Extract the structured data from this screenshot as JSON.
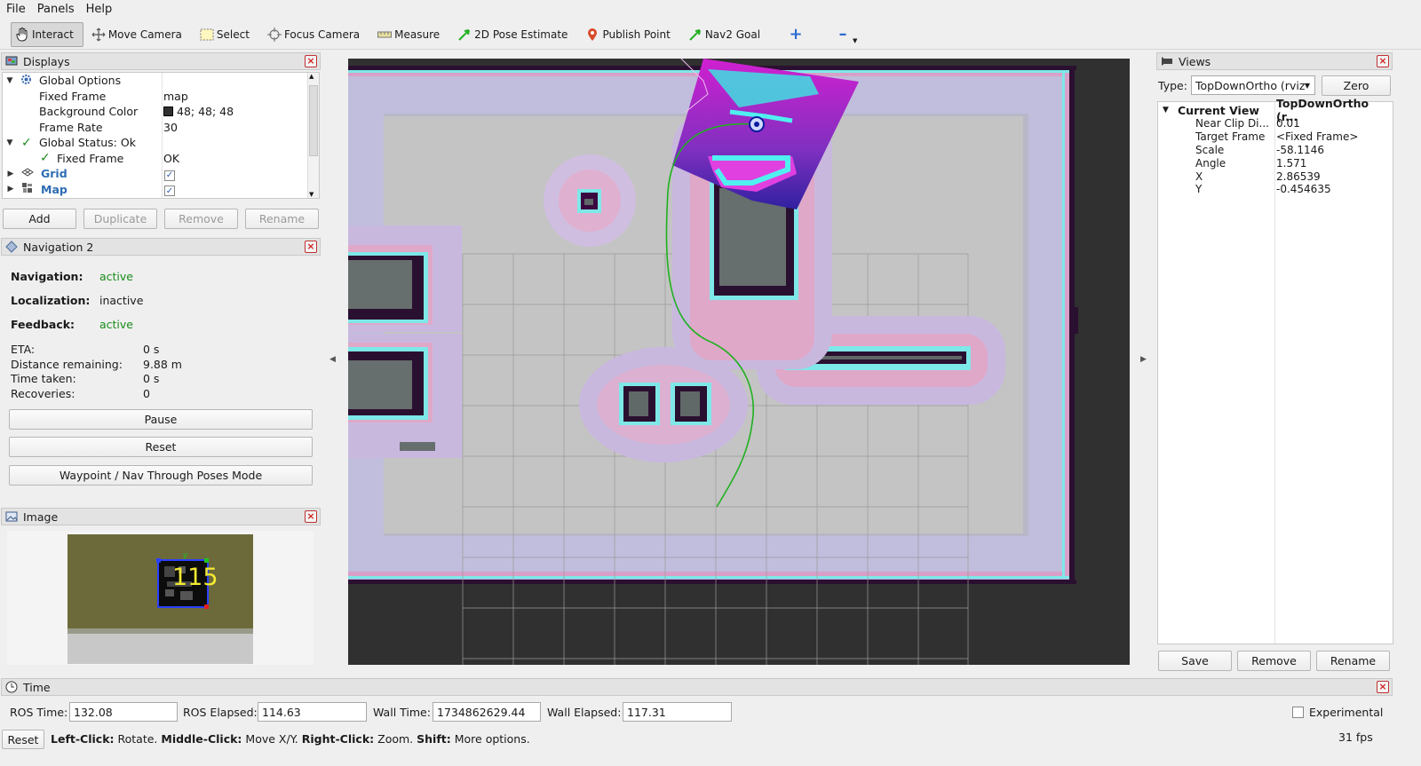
{
  "menu": [
    "File",
    "Panels",
    "Help"
  ],
  "toolbar": {
    "interact": "Interact",
    "move_camera": "Move Camera",
    "select": "Select",
    "focus_camera": "Focus Camera",
    "measure": "Measure",
    "pose_estimate": "2D Pose Estimate",
    "publish_point": "Publish Point",
    "nav2_goal": "Nav2 Goal"
  },
  "displays": {
    "title": "Displays",
    "rows": {
      "global_options": "Global Options",
      "fixed_frame": "Fixed Frame",
      "fixed_frame_val": "map",
      "background_color": "Background Color",
      "background_color_val": "48; 48; 48",
      "background_color_hex": "#303030",
      "frame_rate": "Frame Rate",
      "frame_rate_val": "30",
      "global_status": "Global Status: Ok",
      "status_fixed_frame": "Fixed Frame",
      "status_fixed_frame_val": "OK",
      "grid": "Grid",
      "map": "Map"
    },
    "buttons": {
      "add": "Add",
      "duplicate": "Duplicate",
      "remove": "Remove",
      "rename": "Rename"
    }
  },
  "navigation": {
    "title": "Navigation 2",
    "navigation_label": "Navigation:",
    "navigation_val": "active",
    "localization_label": "Localization:",
    "localization_val": "inactive",
    "feedback_label": "Feedback:",
    "feedback_val": "active",
    "eta_label": "ETA:",
    "eta_val": "0 s",
    "distance_label": "Distance remaining:",
    "distance_val": "9.88 m",
    "time_label": "Time taken:",
    "time_val": "0 s",
    "recoveries_label": "Recoveries:",
    "recoveries_val": "0",
    "pause": "Pause",
    "reset": "Reset",
    "waypoint": "Waypoint / Nav Through Poses Mode"
  },
  "image_panel": {
    "title": "Image",
    "marker_text": "115",
    "axis_label": "y"
  },
  "views": {
    "title": "Views",
    "type_label": "Type:",
    "type_val": "TopDownOrtho (rviz",
    "zero": "Zero",
    "current_view": "Current View",
    "current_view_val": "TopDownOrtho (r...",
    "props": [
      {
        "k": "Near Clip Di...",
        "v": "0.01"
      },
      {
        "k": "Target Frame",
        "v": "<Fixed Frame>"
      },
      {
        "k": "Scale",
        "v": "-58.1146"
      },
      {
        "k": "Angle",
        "v": "1.571"
      },
      {
        "k": "X",
        "v": "2.86539"
      },
      {
        "k": "Y",
        "v": "-0.454635"
      }
    ],
    "save": "Save",
    "remove": "Remove",
    "rename": "Rename"
  },
  "time": {
    "title": "Time",
    "ros_time_label": "ROS Time:",
    "ros_time": "132.08",
    "ros_elapsed_label": "ROS Elapsed:",
    "ros_elapsed": "114.63",
    "wall_time_label": "Wall Time:",
    "wall_time": "1734862629.44",
    "wall_elapsed_label": "Wall Elapsed:",
    "wall_elapsed": "117.31",
    "experimental": "Experimental"
  },
  "status": {
    "reset": "Reset",
    "left_click": "Left-Click:",
    "left_click_desc": "Rotate.",
    "middle_click": "Middle-Click:",
    "middle_click_desc": "Move X/Y.",
    "right_click": "Right-Click:",
    "right_click_desc": "Zoom.",
    "shift": "Shift:",
    "shift_desc": "More options.",
    "fps": "31 fps"
  }
}
